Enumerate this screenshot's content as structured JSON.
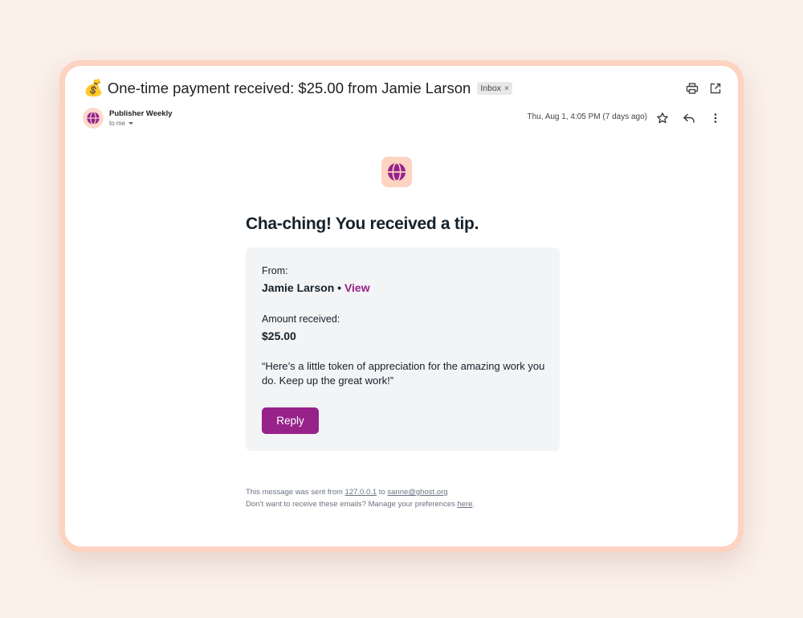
{
  "email": {
    "subject_emoji": "💰",
    "subject": "One-time payment received: $25.00 from Jamie Larson",
    "label_chip": "Inbox",
    "label_chip_remove": "×"
  },
  "sender": {
    "name": "Publisher Weekly",
    "recipient": "to me",
    "date": "Thu, Aug 1, 4:05 PM (7 days ago)"
  },
  "body": {
    "heading": "Cha-ching! You received a tip.",
    "from_label": "From:",
    "from_name": "Jamie Larson",
    "separator": " • ",
    "view_link": "View",
    "amount_label": "Amount received:",
    "amount_value": "$25.00",
    "message": "“Here’s a little token of appreciation for the amazing work you do. Keep up the great work!”",
    "reply_button": "Reply"
  },
  "footer": {
    "line1_prefix": "This message was sent from ",
    "site_link": "127.0.0.1",
    "line1_mid": " to ",
    "email_link": "sanne@ghost.org",
    "line2_prefix": "Don’t want to receive these emails? Manage your preferences ",
    "prefs_link": "here",
    "line2_suffix": "."
  },
  "icons": {
    "top": [
      "printer-icon",
      "open-in-new-window-icon"
    ],
    "row": [
      "star-icon",
      "reply-arrow-icon",
      "more-vertical-icon"
    ],
    "brand": "globe-icon"
  },
  "colors": {
    "accent": "#96228a",
    "link_purple": "#9a1f8a",
    "frame_peach": "#fdd3c1",
    "page_bg": "#fbf0ea",
    "card_bg": "#f3f4f6"
  }
}
